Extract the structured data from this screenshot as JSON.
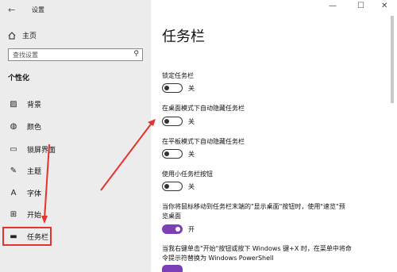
{
  "window": {
    "title": "设置",
    "controls": [
      "—",
      "☐",
      "✕"
    ],
    "back": "←"
  },
  "sidebar": {
    "home": {
      "label": "主页",
      "icon": "home-icon"
    },
    "search": {
      "placeholder": "查找设置"
    },
    "section": "个性化",
    "items": [
      {
        "label": "背景",
        "icon": "image-icon",
        "glyph": "▨"
      },
      {
        "label": "颜色",
        "icon": "palette-icon",
        "glyph": "◍"
      },
      {
        "label": "锁屏界面",
        "icon": "lock-screen-icon",
        "glyph": "▭"
      },
      {
        "label": "主题",
        "icon": "brush-icon",
        "glyph": "✎"
      },
      {
        "label": "字体",
        "icon": "font-icon",
        "glyph": "A"
      },
      {
        "label": "开始",
        "icon": "start-icon",
        "glyph": "⊞"
      },
      {
        "label": "任务栏",
        "icon": "taskbar-icon",
        "glyph": "▬"
      }
    ]
  },
  "main": {
    "title": "任务栏",
    "settings": [
      {
        "label": "锁定任务栏",
        "state": "关",
        "on": false
      },
      {
        "label": "在桌面模式下自动隐藏任务栏",
        "state": "关",
        "on": false
      },
      {
        "label": "在平板模式下自动隐藏任务栏",
        "state": "关",
        "on": false
      },
      {
        "label": "使用小任务栏按钮",
        "state": "关",
        "on": false
      },
      {
        "label_line1": "当你将鼠标移动到任务栏末端的\"显示桌面\"按钮时，使用\"速览\"预",
        "label_line2": "览桌面",
        "state": "开",
        "on": true
      },
      {
        "label_line1": "当我右键单击\"开始\"按钮或按下 Windows 键+X 时，在菜单中将命",
        "label_line2": "令提示符替换为 Windows PowerShell"
      }
    ]
  },
  "colors": {
    "accent": "#7b3fb6",
    "annotation": "#e6322e",
    "sidebar_bg": "#ececec"
  }
}
